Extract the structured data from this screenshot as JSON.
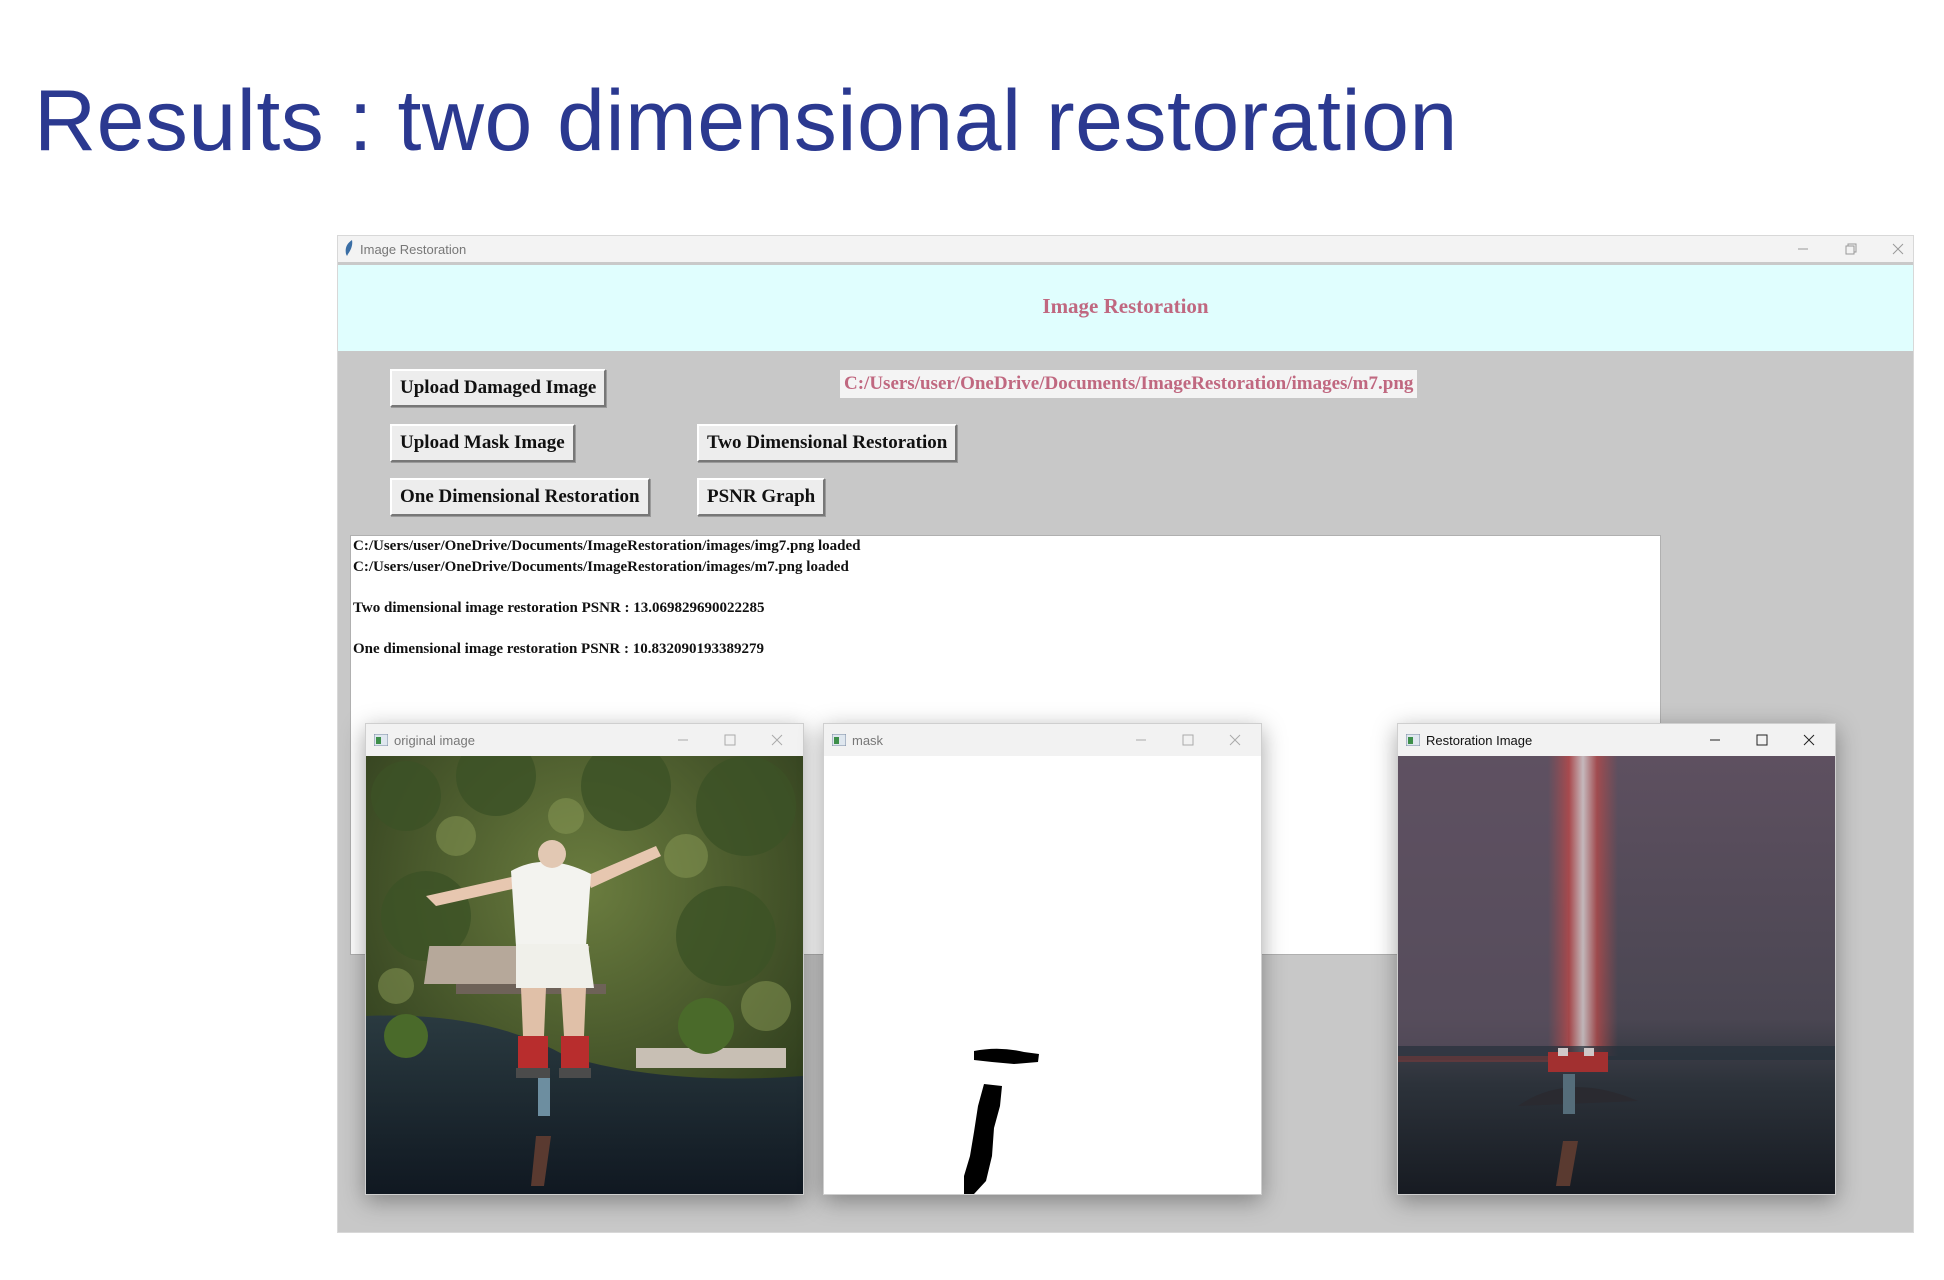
{
  "slide": {
    "title": "Results : two dimensional restoration"
  },
  "app": {
    "window_title": "Image Restoration",
    "header": "Image Restoration",
    "buttons": {
      "upload_damaged": "Upload Damaged Image",
      "upload_mask": "Upload Mask Image",
      "two_dim": "Two Dimensional Restoration",
      "one_dim": "One Dimensional Restoration",
      "psnr_graph": "PSNR Graph"
    },
    "path_label": "C:/Users/user/OneDrive/Documents/ImageRestoration/images/m7.png",
    "log": [
      "C:/Users/user/OneDrive/Documents/ImageRestoration/images/img7.png loaded",
      "C:/Users/user/OneDrive/Documents/ImageRestoration/images/m7.png loaded",
      "Two dimensional image restoration PSNR : 13.069829690022285",
      "One dimensional image restoration PSNR : 10.832090193389279"
    ]
  },
  "windows": {
    "original": {
      "title": "original image"
    },
    "mask": {
      "title": "mask"
    },
    "restoration": {
      "title": "Restoration Image"
    }
  },
  "colors": {
    "title": "#2b3990",
    "accent_text": "#c06880",
    "header_band": "#e0fefe",
    "app_bg": "#c8c8c8"
  },
  "icons": [
    "feather-icon",
    "minimize-icon",
    "maximize-icon",
    "close-icon",
    "opencv-window-icon"
  ]
}
